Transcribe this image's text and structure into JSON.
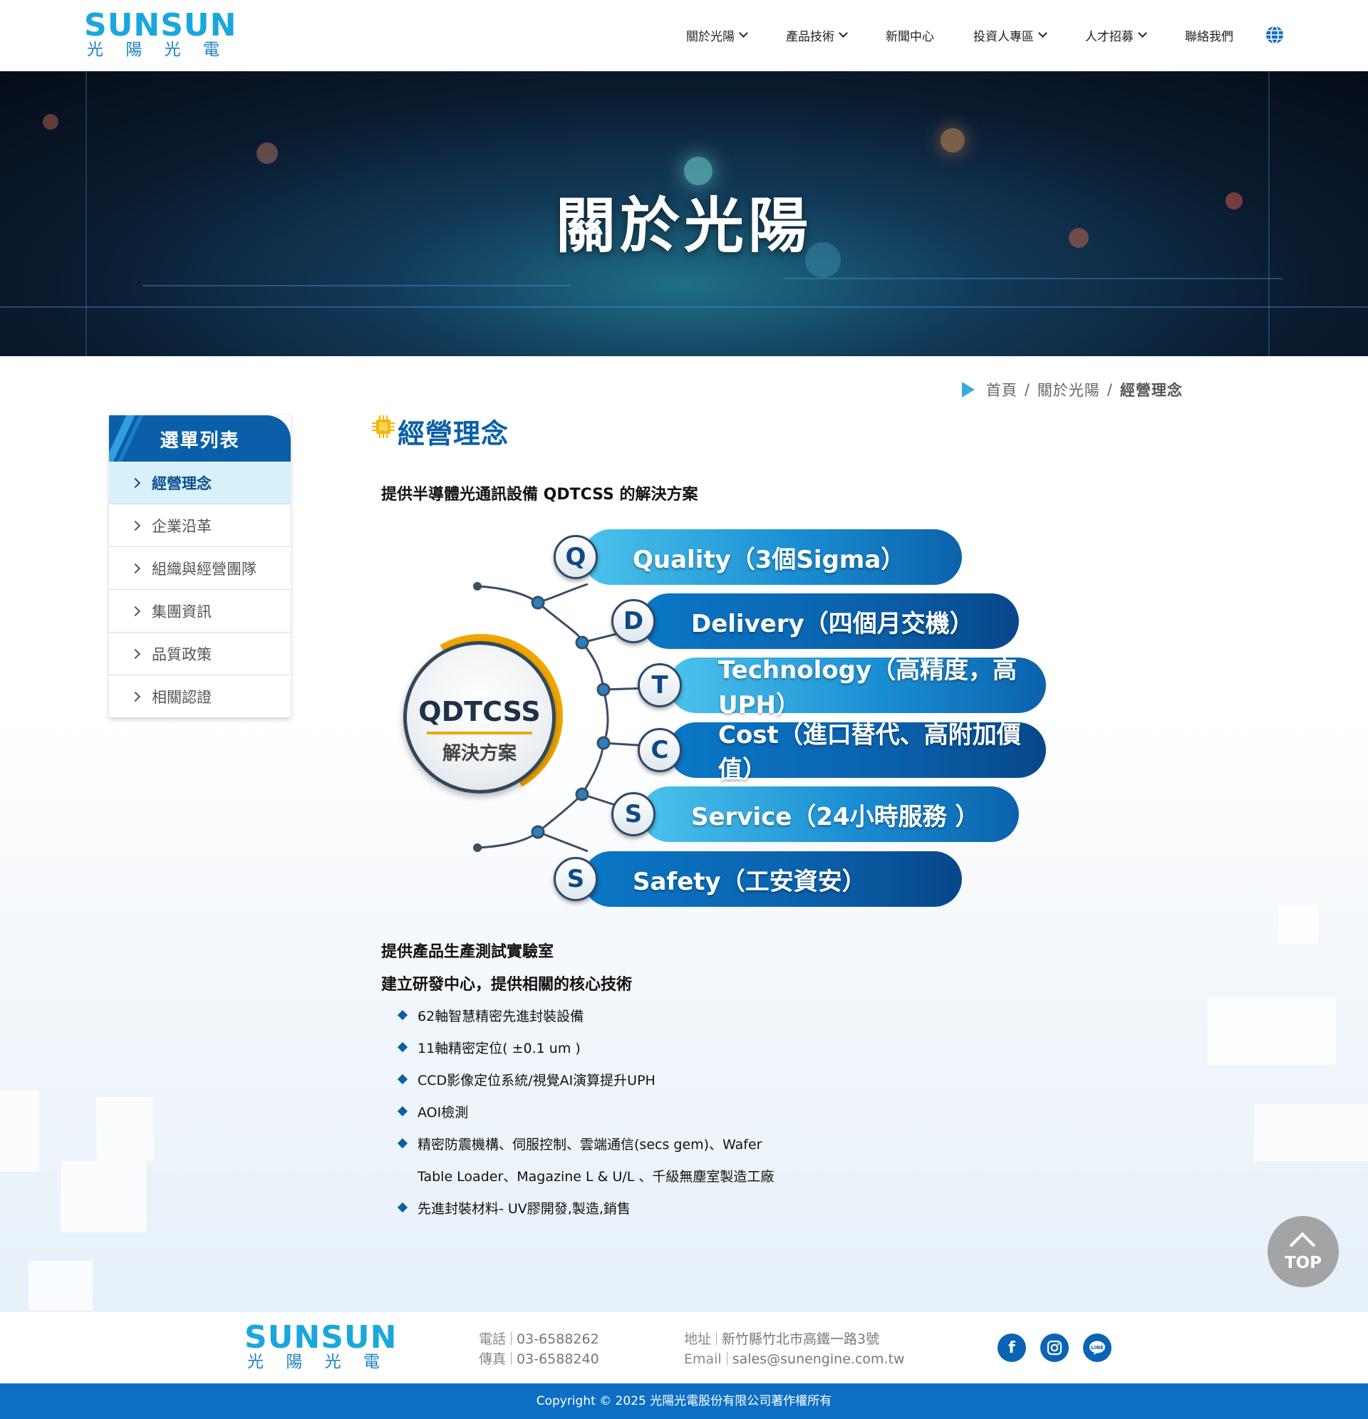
{
  "brand": {
    "logo_en": "SUNSUN",
    "logo_zh": [
      "光",
      "陽",
      "光",
      "電"
    ]
  },
  "nav": {
    "items": [
      {
        "label": "關於光陽",
        "dropdown": true
      },
      {
        "label": "產品技術",
        "dropdown": true
      },
      {
        "label": "新聞中心",
        "dropdown": false
      },
      {
        "label": "投資人專區",
        "dropdown": true
      },
      {
        "label": "人才招募",
        "dropdown": true
      },
      {
        "label": "聯絡我們",
        "dropdown": false
      }
    ],
    "language_icon": "globe-icon"
  },
  "banner": {
    "title": "關於光陽"
  },
  "breadcrumb": {
    "home": "首頁",
    "parent": "關於光陽",
    "current": "經營理念",
    "separator": "/"
  },
  "sidebar": {
    "title": "選單列表",
    "items": [
      {
        "label": "經營理念",
        "active": true
      },
      {
        "label": "企業沿革"
      },
      {
        "label": "組織與經營團隊"
      },
      {
        "label": "集團資訊"
      },
      {
        "label": "品質政策"
      },
      {
        "label": "相關認證"
      }
    ]
  },
  "main": {
    "title": "經營理念",
    "intro": "提供半導體光通訊設備 QDTCSS 的解決方案",
    "diagram": {
      "center_title": "QDTCSS",
      "center_subtitle": "解決方案",
      "items": [
        {
          "letter": "Q",
          "text": "Quality（3個Sigma）"
        },
        {
          "letter": "D",
          "text": "Delivery（四個月交機）"
        },
        {
          "letter": "T",
          "text": "Technology（高精度，高UPH）"
        },
        {
          "letter": "C",
          "text": "Cost（進口替代、高附加價值）"
        },
        {
          "letter": "S",
          "text": "Service（24小時服務 ）"
        },
        {
          "letter": "S",
          "text": "Safety（工安資安）"
        }
      ]
    },
    "lab_heading": "提供產品生產測試實驗室",
    "rd_heading": "建立研發中心，提供相關的核心技術",
    "bullets": [
      "62軸智慧精密先進封裝設備",
      "11軸精密定位( ±0.1 um )",
      "CCD影像定位系統/視覺AI演算提升UPH",
      "AOI檢測",
      "精密防震機構、伺服控制、雲端通信(secs gem)、Wafer",
      "Table Loader、Magazine L & U/L 、千級無塵室製造工廠",
      "先進封裝材料- UV膠開發,製造,銷售"
    ]
  },
  "back_to_top": {
    "label": "TOP"
  },
  "footer": {
    "phone_label": "電話",
    "phone": "03-6588262",
    "fax_label": "傳真",
    "fax": "03-6588240",
    "address_label": "地址",
    "address": "新竹縣竹北市高鐵一路3號",
    "email_label": "Email",
    "email": "sales@sunengine.com.tw",
    "social": [
      "facebook-icon",
      "instagram-icon",
      "line-icon"
    ],
    "copyright": "Copyright © 2025 光陽光電股份有限公司著作權所有"
  },
  "colors": {
    "brand_blue": "#0b5fa8",
    "accent_cyan": "#19a7dd",
    "ring_gold": "#f2a600",
    "footer_bar": "#0d6fc4"
  }
}
